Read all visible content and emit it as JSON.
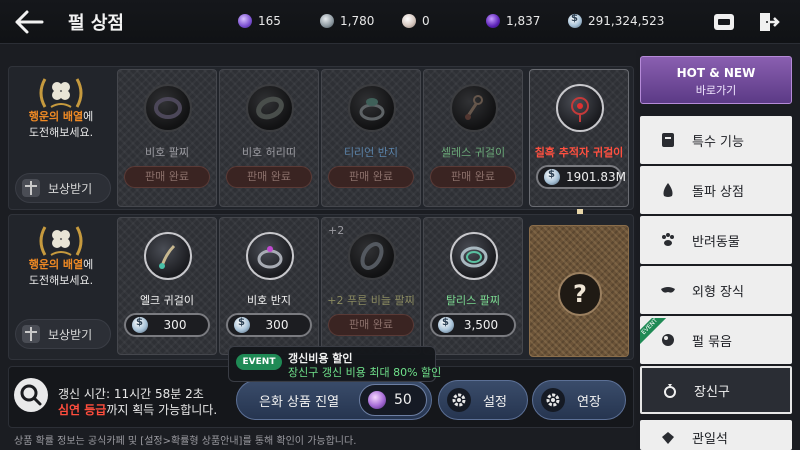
{
  "header": {
    "title": "펄 상점",
    "currencies": [
      {
        "icon": "purple-gem-icon",
        "value": "165"
      },
      {
        "icon": "silver-coin-icon",
        "value": "1,780"
      },
      {
        "icon": "pearl-icon",
        "value": "0"
      },
      {
        "icon": "violet-orb-icon",
        "value": "1,837"
      },
      {
        "icon": "silver-icon",
        "value": "291,324,523"
      }
    ]
  },
  "fortune": {
    "highlight": "행운의 배열",
    "text_suffix": "에",
    "text_line2": "도전해보세요.",
    "reward_label": "보상받기"
  },
  "row1": [
    {
      "name": "비호 팔찌",
      "status": "판매 완료"
    },
    {
      "name": "비호 허리띠",
      "status": "판매 완료"
    },
    {
      "name": "티리언 반지",
      "status": "판매 완료"
    },
    {
      "name": "셀레스 귀걸이",
      "status": "판매 완료"
    },
    {
      "name": "칠흑 추적자 귀걸이",
      "price": "1901.83M"
    }
  ],
  "row2": [
    {
      "name": "엘크 귀걸이",
      "price": "300"
    },
    {
      "name": "비호 반지",
      "price": "300"
    },
    {
      "name": "+2 푸른 비늘 팔찌",
      "status": "판매 완료",
      "enhance": "+2"
    },
    {
      "name": "탈리스 팔찌",
      "price": "3,500"
    }
  ],
  "mystery_label": "?",
  "refresh": {
    "time_line": "갱신 시간: 11시간 58분 2초",
    "grade": "심연 등급",
    "grade_suffix": "까지 획득 가능합니다."
  },
  "event": {
    "badge": "EVENT",
    "title": "갱신비용 할인",
    "subtitle": "장신구 갱신 비용 최대 80% 할인"
  },
  "actions": {
    "enter_label": "은화 상품 진열",
    "enter_cost": "50",
    "settings_label": "설정",
    "extend_label": "연장"
  },
  "footer_note": "상품 확률 정보는 공식카페 및 [설정>확률형 상품안내]를 통해 확인이 가능합니다.",
  "sidebar": {
    "hotnew_title": "HOT & NEW",
    "hotnew_sub": "바로가기",
    "items": [
      {
        "label": "특수 기능",
        "icon": "scroll-icon"
      },
      {
        "label": "돌파 상점",
        "icon": "stone-icon"
      },
      {
        "label": "반려동물",
        "icon": "paw-icon"
      },
      {
        "label": "외형 장식",
        "icon": "mask-icon"
      },
      {
        "label": "펄 묶음",
        "icon": "pearl-bundle-icon"
      },
      {
        "label": "장신구",
        "icon": "ring-icon"
      },
      {
        "label": "관일석",
        "icon": "gem-icon"
      }
    ],
    "new_badge": "EVENT"
  },
  "colors": {
    "accent_orange": "#f08a24",
    "red_text": "#ff4d3d",
    "event_green": "#1f8a55",
    "hotnew_purple": "#7a4fa8"
  }
}
